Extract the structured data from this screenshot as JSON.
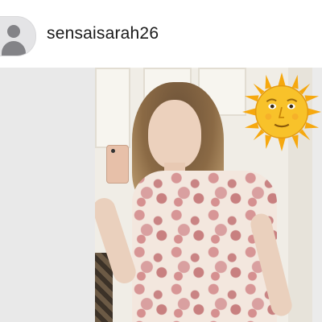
{
  "profile": {
    "username": "sensaisarah26",
    "avatar_icon": "default-user-avatar-icon"
  },
  "post": {
    "photo_description_icon": "mirror-selfie-photo",
    "sticker_icon": "sun-with-face-emoji"
  },
  "colors": {
    "background": "#ffffff",
    "avatar_fill": "#838387",
    "post_bg": "#ebebeb",
    "sun_yellow": "#f6b40e"
  }
}
